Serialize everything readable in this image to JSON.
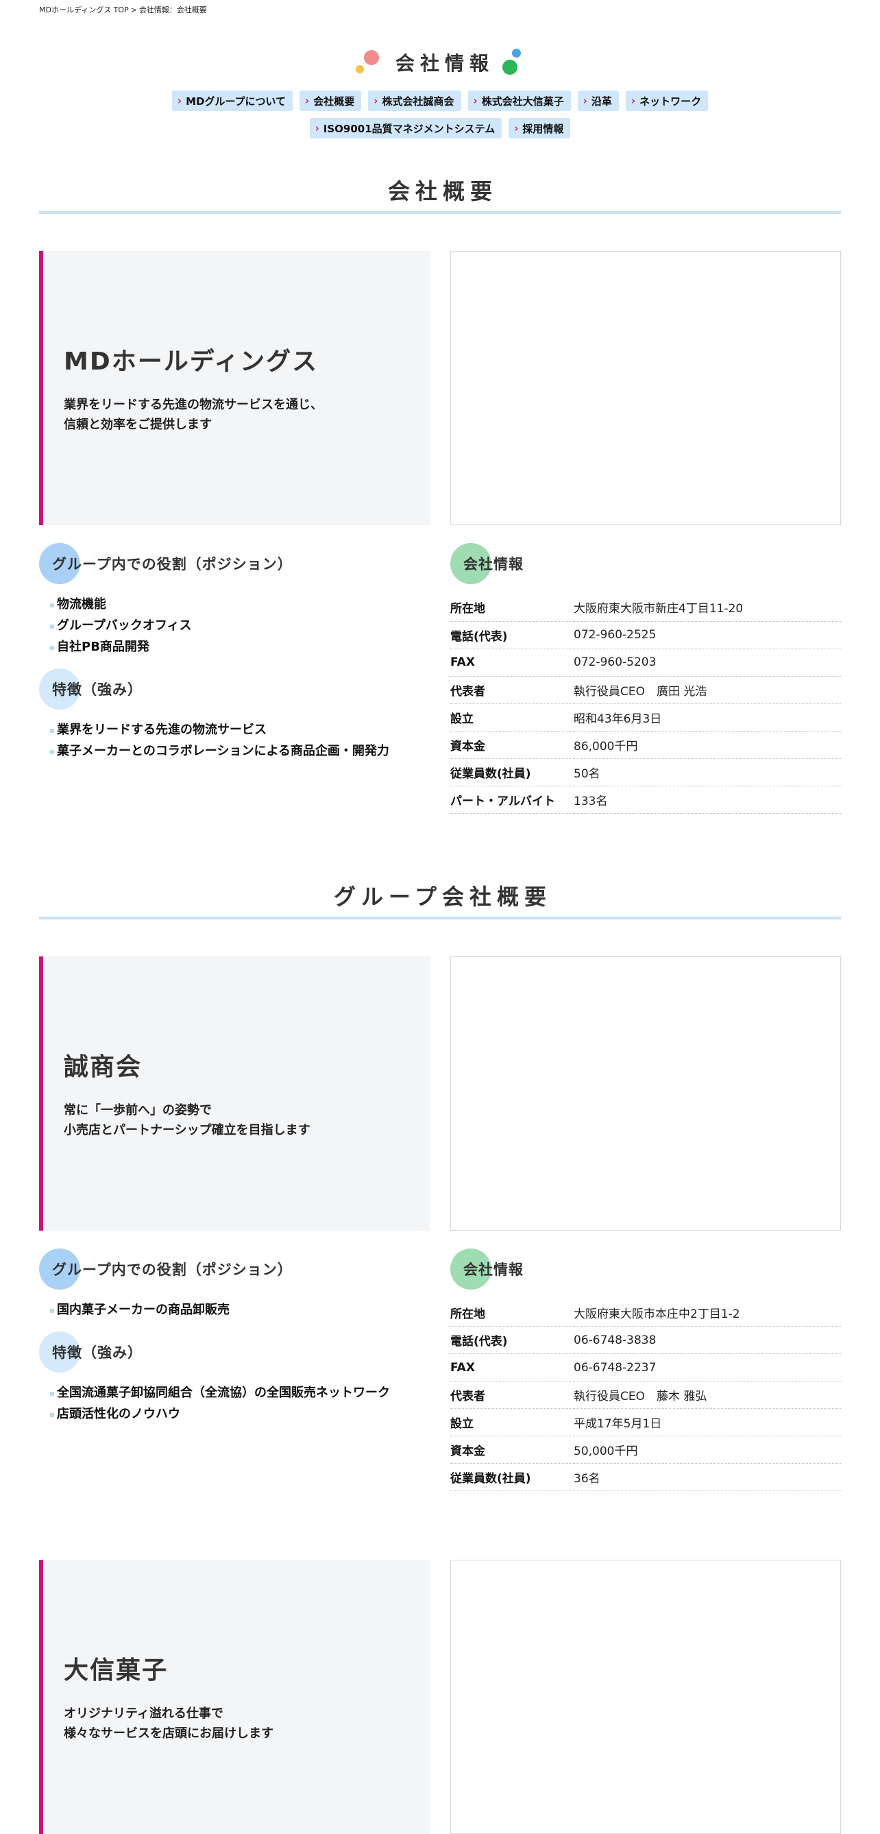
{
  "breadcrumb": {
    "home": "MDホールディングス TOP",
    "separator": ">",
    "current": "会社情報：会社概要"
  },
  "page_title": "会社情報",
  "colors": {
    "accent": "#c8147a",
    "nav_bg": "#cfe6fb",
    "rule": "#c9e2f5",
    "dot_pink": "#f28b8b",
    "dot_orange": "#f6c24a",
    "dot_blue": "#4aa3e8",
    "dot_green": "#2bb559"
  },
  "nav": [
    {
      "label": "MDグループについて"
    },
    {
      "label": "会社概要"
    },
    {
      "label": "株式会社誠商会"
    },
    {
      "label": "株式会社大信菓子"
    },
    {
      "label": "沿革"
    },
    {
      "label": "ネットワーク"
    },
    {
      "label": "ISO9001品質マネジメントシステム"
    },
    {
      "label": "採用情報"
    }
  ],
  "sections": {
    "overview": "会社概要",
    "group": "グループ会社概要"
  },
  "labels": {
    "role": "グループ内での役割（ポジション）",
    "strength": "特徴（強み）",
    "info": "会社情報"
  },
  "md": {
    "name": "MDホールディングス",
    "desc1": "業界をリードする先進の物流サービスを通じ、",
    "desc2": "信頼と効率をご提供します",
    "roles": [
      "物流機能",
      "グループバックオフィス",
      "自社PB商品開発"
    ],
    "strengths": [
      "業界をリードする先進の物流サービス",
      "菓子メーカーとのコラボレーションによる商品企画・開発力"
    ],
    "info": [
      {
        "k": "所在地",
        "v": "大阪府東大阪市新庄4丁目11-20"
      },
      {
        "k": "電話(代表)",
        "v": "072-960-2525"
      },
      {
        "k": "FAX",
        "v": "072-960-5203"
      },
      {
        "k": "代表者",
        "v": "執行役員CEO　廣田 光浩"
      },
      {
        "k": "設立",
        "v": "昭和43年6月3日"
      },
      {
        "k": "資本金",
        "v": "86,000千円"
      },
      {
        "k": "従業員数(社員)",
        "v": "50名"
      },
      {
        "k": "パート・アルバイト",
        "v": "133名"
      }
    ]
  },
  "seisho": {
    "name": "誠商会",
    "desc1": "常に「一歩前へ」の姿勢で",
    "desc2": "小売店とパートナーシップ確立を目指します",
    "roles": [
      "国内菓子メーカーの商品卸販売"
    ],
    "strengths": [
      "全国流通菓子卸協同組合（全流協）の全国販売ネットワーク",
      "店頭活性化のノウハウ"
    ],
    "info": [
      {
        "k": "所在地",
        "v": "大阪府東大阪市本庄中2丁目1-2"
      },
      {
        "k": "電話(代表)",
        "v": "06-6748-3838"
      },
      {
        "k": "FAX",
        "v": "06-6748-2237"
      },
      {
        "k": "代表者",
        "v": "執行役員CEO　藤木 雅弘"
      },
      {
        "k": "設立",
        "v": "平成17年5月1日"
      },
      {
        "k": "資本金",
        "v": "50,000千円"
      },
      {
        "k": "従業員数(社員)",
        "v": "36名"
      }
    ]
  },
  "daishin": {
    "name": "大信菓子",
    "desc1": "オリジナリティ溢れる仕事で",
    "desc2": "様々なサービスを店頭にお届けします"
  }
}
